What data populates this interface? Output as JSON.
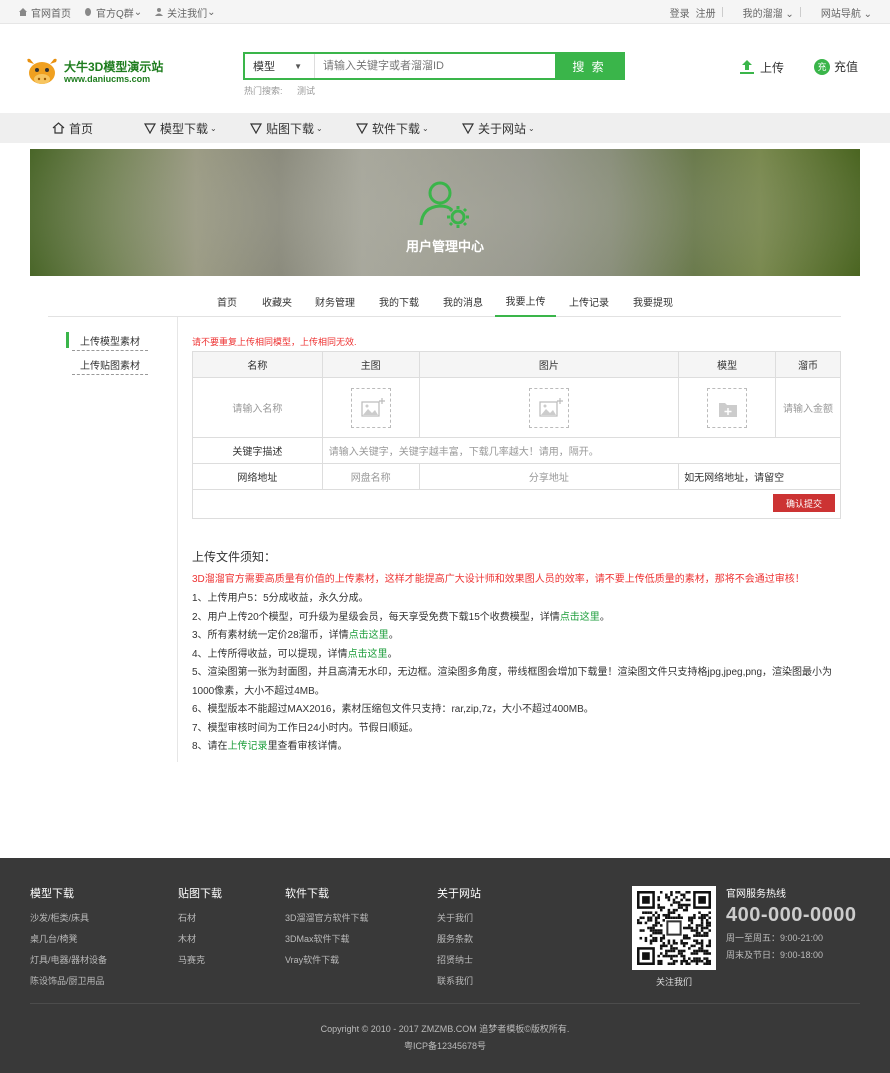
{
  "topbar": {
    "left": [
      "官网首页",
      "官方Q群",
      "关注我们"
    ],
    "right": [
      "登录",
      "注册",
      "我的溜溜",
      "网站导航"
    ]
  },
  "logo": {
    "name": "大牛3D模型演示站",
    "url": "www.daniucms.com"
  },
  "search": {
    "category": "模型",
    "placeholder": "请输入关键字或者溜溜ID",
    "button": "搜 索",
    "hot_label": "热门搜索:",
    "hot_terms": [
      "测试"
    ]
  },
  "header_actions": {
    "upload": "上传",
    "recharge_badge": "充",
    "recharge": "充值"
  },
  "nav": [
    "首页",
    "模型下载",
    "贴图下载",
    "软件下载",
    "关于网站"
  ],
  "banner": {
    "title": "用户管理中心"
  },
  "tabs": [
    "首页",
    "收藏夹",
    "财务管理",
    "我的下载",
    "我的消息",
    "我要上传",
    "上传记录",
    "我要提现"
  ],
  "active_tab": "我要上传",
  "sidebar": [
    "上传模型素材",
    "上传贴图素材"
  ],
  "form": {
    "warning": "请不要重复上传相同模型，上传相同无效.",
    "headers": [
      "名称",
      "主图",
      "图片",
      "模型",
      "溜币"
    ],
    "name_placeholder": "请输入名称",
    "amount_placeholder": "请输入金额",
    "keyword_label": "关键字描述",
    "keyword_placeholder": "请输入关键字，关键字越丰富，下载几率越大！请用，隔开。",
    "netdisk_label": "网络地址",
    "netdisk_name": "网盘名称",
    "share_url": "分享地址",
    "no_url_hint": "如无网络地址，请留空",
    "submit": "确认提交"
  },
  "notice": {
    "title": "上传文件须知：",
    "highlight": "3D溜溜官方需要高质量有价值的上传素材，这样才能提高广大设计师和效果图人员的效率，请不要上传低质量的素材，那将不会通过审核！",
    "items": [
      {
        "pre": "1、上传用户5：5分成收益，永久分成。",
        "link": "",
        "post": ""
      },
      {
        "pre": "2、用户上传20个模型，可升级为星级会员，每天享受免费下载15个收费模型，详情",
        "link": "点击这里",
        "post": "。"
      },
      {
        "pre": "3、所有素材统一定价28溜币，详情",
        "link": "点击这里",
        "post": "。"
      },
      {
        "pre": "4、上传所得收益，可以提现，详情",
        "link": "点击这里",
        "post": "。"
      },
      {
        "pre": "5、渲染图第一张为封面图，并且高清无水印，无边框。渲染图多角度，带线框图会增加下载量！渲染图文件只支持格jpg,jpeg,png，渲染图最小为1000像素，大小不超过4MB。",
        "link": "",
        "post": ""
      },
      {
        "pre": "6、模型版本不能超过MAX2016，素材压缩包文件只支持：rar,zip,7z，大小不超过400MB。",
        "link": "",
        "post": ""
      },
      {
        "pre": "7、模型审核时间为工作日24小时内。节假日顺延。",
        "link": "",
        "post": ""
      },
      {
        "pre": "8、请在",
        "link": "上传记录",
        "post": "里查看审核详情。"
      }
    ]
  },
  "footer": {
    "cols": [
      {
        "title": "模型下载",
        "items": [
          "沙发/柜类/床具",
          "桌几台/椅凳",
          "灯具/电器/器材设备",
          "陈设饰品/厨卫用品"
        ]
      },
      {
        "title": "贴图下载",
        "items": [
          "石材",
          "木材",
          "马赛克"
        ]
      },
      {
        "title": "软件下载",
        "items": [
          "3D溜溜官方软件下载",
          "3DMax软件下载",
          "Vray软件下载"
        ]
      },
      {
        "title": "关于网站",
        "items": [
          "关于我们",
          "服务条款",
          "招贤纳士",
          "联系我们"
        ]
      }
    ],
    "qr_caption": "关注我们",
    "hotline_title": "官网服务热线",
    "hotline": "400-000-0000",
    "weekday": "周一至周五：9:00-21:00",
    "weekend": "周末及节日：9:00-18:00",
    "copyright": "Copyright © 2010 - 2017 ZMZMB.COM 追梦者模板©版权所有.",
    "icp": "粤ICP备12345678号"
  },
  "colors": {
    "accent": "#3ab54a",
    "danger": "#cc3333",
    "footer_bg": "#393939"
  }
}
